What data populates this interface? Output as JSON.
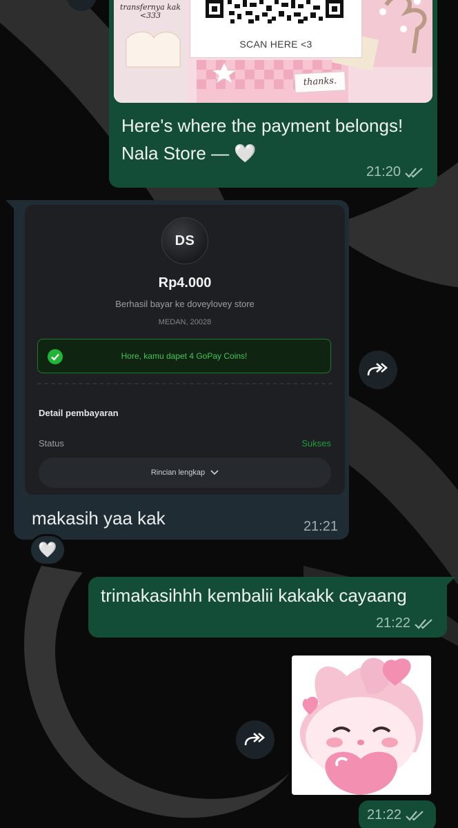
{
  "messages": [
    {
      "id": "payment-image",
      "direction": "outgoing",
      "image_texts": {
        "note": "transfernya kak <333",
        "scan": "SCAN HERE <3",
        "thanks": "thanks."
      },
      "caption": "Here's where the payment belongs! Nala Store — 🤍",
      "time": "21:20",
      "status": "read"
    },
    {
      "id": "receipt",
      "direction": "incoming",
      "receipt": {
        "avatar_initials": "DS",
        "amount": "Rp4.000",
        "merchant_line": "Berhasil bayar ke doveylovey store",
        "location": "MEDAN, 20028",
        "coins_banner": "Hore, kamu dapet 4 GoPay Coins!",
        "detail_title": "Detail pembayaran",
        "status_label": "Status",
        "status_value": "Sukses",
        "details_button": "Rincian lengkap"
      },
      "text": "makasih yaa kak",
      "time": "21:21",
      "reaction": "🤍"
    },
    {
      "id": "thanks-reply",
      "direction": "outgoing",
      "text": "trimakasihhh kembalii kakakk cayaang",
      "time": "21:22",
      "status": "read"
    },
    {
      "id": "sticker",
      "direction": "outgoing",
      "sticker": "pink bunny holding heart",
      "time": "21:22",
      "status": "read"
    }
  ],
  "icons": {
    "forward": "forward-icon",
    "read": "double-check-icon",
    "success": "check-circle-icon",
    "expand": "chevron-down-icon"
  },
  "colors": {
    "outgoing_bubble": "#134d37",
    "incoming_bubble": "#1f2c34",
    "success_green": "#21b33a",
    "background": "#0b0b0b"
  }
}
